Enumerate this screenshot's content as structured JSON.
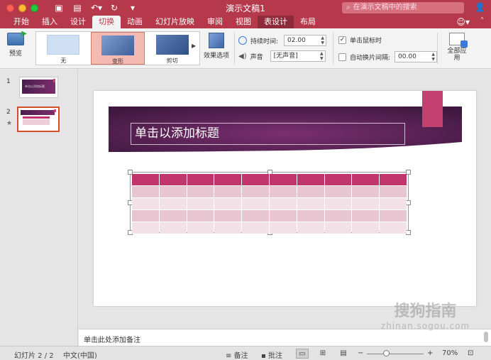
{
  "window": {
    "title": "演示文稿1",
    "search_placeholder": "在演示文稿中的搜索"
  },
  "tabs": [
    {
      "label": "开始"
    },
    {
      "label": "插入"
    },
    {
      "label": "设计"
    },
    {
      "label": "切换",
      "active": true
    },
    {
      "label": "动画"
    },
    {
      "label": "幻灯片放映"
    },
    {
      "label": "审阅"
    },
    {
      "label": "视图"
    },
    {
      "label": "表设计",
      "contextual": true
    },
    {
      "label": "布局",
      "contextual": true
    }
  ],
  "ribbon": {
    "preview_label": "预览",
    "gallery": [
      {
        "label": "无"
      },
      {
        "label": "变形",
        "selected": true
      },
      {
        "label": "剪切"
      }
    ],
    "effect_options_label": "效果选项",
    "duration_label": "持续时间:",
    "duration_value": "02.00",
    "sound_label": "声音",
    "sound_value": "[无声音]",
    "on_click_label": "单击鼠标时",
    "on_click_checked": true,
    "auto_advance_label": "自动换片间隔:",
    "auto_advance_checked": false,
    "auto_advance_value": "00.00",
    "apply_all_label": "全部应用"
  },
  "slides": {
    "thumb_numbers": [
      "1",
      "2"
    ],
    "thumb1_title": "单击以添加标题"
  },
  "slide": {
    "title_placeholder": "单击以添加标题",
    "table": {
      "columns": 10,
      "rows": 5
    }
  },
  "notes_placeholder": "单击此处添加备注",
  "status": {
    "slide_indicator": "幻灯片 2 / 2",
    "language": "中文(中国)",
    "notes_label": "备注",
    "comments_label": "批注",
    "zoom_minus": "−",
    "zoom_plus": "+",
    "zoom": "70%",
    "zoom_fraction": 0.7
  },
  "watermark": {
    "brand": "搜狗指南",
    "url": "zhinan.sogou.com"
  },
  "colors": {
    "accent": "#b5394a",
    "title_band": "#5a1f52",
    "table_header": "#c0356b",
    "selection": "#f4b9b0"
  },
  "icons": {
    "close": "close-icon",
    "minimize": "minimize-icon",
    "zoom": "zoom-icon",
    "save": "save-icon",
    "undo": "undo-icon",
    "redo": "redo-icon",
    "search": "search-icon",
    "user": "add-user-icon",
    "smiley": "smiley-icon"
  }
}
